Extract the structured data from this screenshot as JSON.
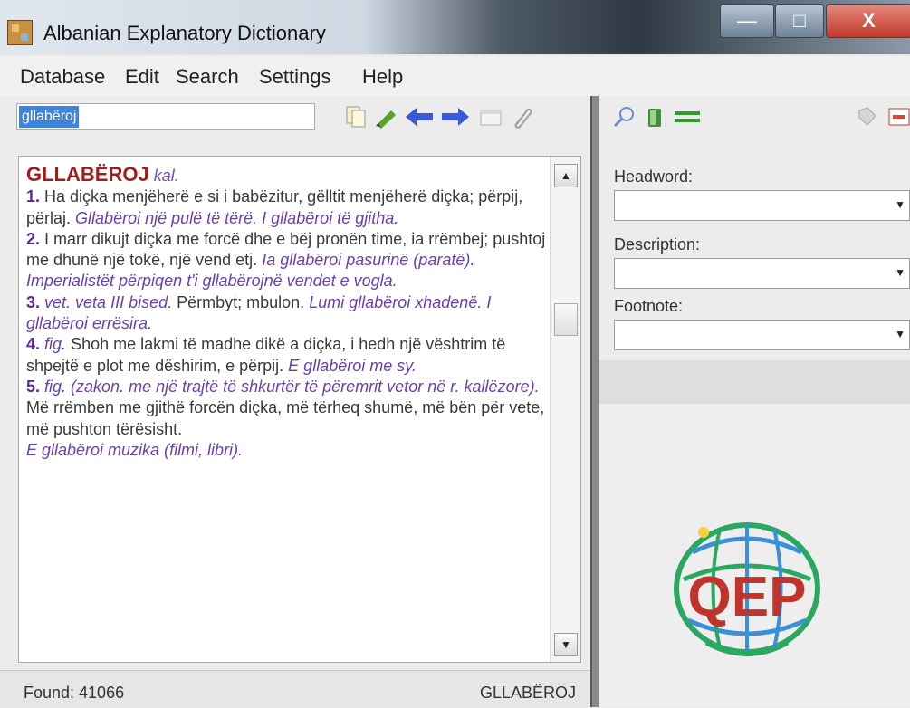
{
  "window": {
    "title": "Albanian Explanatory Dictionary",
    "min_label": "—",
    "max_label": "□",
    "close_label": "X"
  },
  "menu": [
    "Database",
    "Edit",
    "Search",
    "Settings",
    "Help"
  ],
  "search": {
    "value": "gllabëroj"
  },
  "entry": {
    "headword": "GLLABËROJ",
    "pos": "kal.",
    "senses": [
      {
        "num": "1.",
        "def": "Ha diçka menjëherë e si i babëzitur, gëlltit menjëherë diçka; përpij, përlaj.",
        "ex": "Gllabëroi një pulë të tërë. I gllabëroi të gjitha."
      },
      {
        "num": "2.",
        "def": "I marr dikujt diçka me forcë dhe e bëj pronën time, ia rrëmbej; pushtoj me dhunë një tokë, një vend etj.",
        "ex": "Ia gllabëroi pasurinë (paratë). Imperialistët përpiqen t'i gllabërojnë vendet e vogla."
      },
      {
        "num": "3.",
        "gram": "vet. veta III bised.",
        "def": "Përmbyt; mbulon.",
        "ex": "Lumi gllabëroi xhadenë. I gllabëroi errësira."
      },
      {
        "num": "4.",
        "gram": "fig.",
        "def": "Shoh me lakmi të madhe dikë a diçka, i hedh një vështrim të shpejtë e plot me dëshirim, e përpij.",
        "ex": "E gllabëroi me sy."
      },
      {
        "num": "5.",
        "gram": "fig. (zakon. me një trajtë të shkurtër të përemrit vetor në r. kallëzore).",
        "def": "Më rrëmben me gjithë forcën diçka, më tërheq shumë, më bën për vete, më pushton tërësisht.",
        "ex": "E gllabëroi muzika (filmi, libri)."
      }
    ]
  },
  "status": {
    "found": "Found: 41066",
    "current": "GLLABËROJ"
  },
  "filters": {
    "headword_label": "Headword:",
    "description_label": "Description:",
    "footnote_label": "Footnote:"
  },
  "logo": {
    "text": "QEP"
  },
  "colors": {
    "headword": "#a31c1c",
    "sense_number": "#5c2a9a",
    "example": "#6a3fb0",
    "selection": "#3d83e0"
  }
}
